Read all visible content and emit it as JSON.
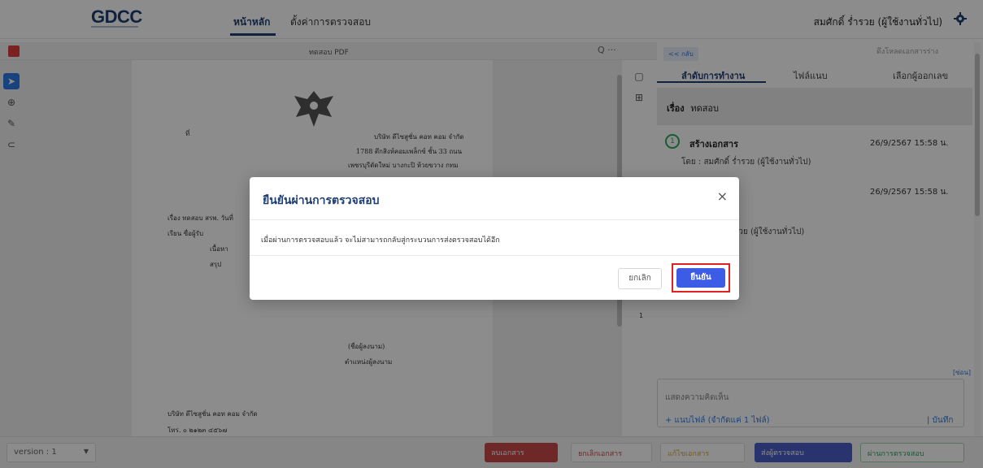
{
  "header": {
    "logo": "GDCC",
    "tabs": [
      {
        "label": "หน้าหลัก"
      },
      {
        "label": "ตั้งค่าการตรวจสอบ"
      }
    ],
    "user": "สมศักดิ์ ร่ำรวย (ผู้ใช้งานทั่วไป)",
    "gear_icon": "gear-icon"
  },
  "viewer": {
    "title": "ทดสอบ PDF",
    "tools_text": "Q ···",
    "page_number": "1"
  },
  "document": {
    "addr_label": "ที่",
    "company": "บริษัท ดีไซสูชั่น คอท คอม จำกัด",
    "address1": "1788 ตึกสิงห์คอมเพล็กซ์ ชั้น 33 ถนน",
    "address2": "เพชรบุรีตัดใหม่ บางกะปิ ห้วยขวาง กทม",
    "subject_line": "เรื่อง   ทดสอบ สรพ. วันที่",
    "to_line": "เรียน   ซื่อผู้รับ",
    "content": "เนื้อหา",
    "summary": "สรุป",
    "signer": "(ชื่อผู้ลงนาม)",
    "position": "ตำแหน่งผู้ลงนาม",
    "footer_company": "บริษัท ดีไซสูชั่น คอท คอม จำกัด",
    "footer_tel": "โทร. ๐ ๒๑๒๓ ๔๕๖๗"
  },
  "right_panel": {
    "back": "<< กลับ",
    "download": "ดึงโหลดเอกสารร่าง",
    "tabs": [
      "ลำดับการทำงาน",
      "ไฟล์แนบ",
      "เลือกผู้ออกเลข"
    ],
    "subject_label": "เรื่อง",
    "subject_value": "ทดสอบ",
    "step1": {
      "num": "1",
      "title": "สร้างเอกสาร",
      "date": "26/9/2567 15:58 น.",
      "by": "โดย : สมศักดิ์ ร่ำรวย (ผู้ใช้งานทั่วไป)"
    },
    "step2": {
      "date": "26/9/2567 15:58 น.",
      "by": "ร่ำรวย (ผู้ใช้งานทั่วไป)"
    },
    "hide": "[ซ่อน]",
    "comment_placeholder": "แสดงความคิดเห็น",
    "attach": "+  แนบไฟล์ (จำกัดแค่ 1 ไฟล์)",
    "save": "|  บันทึก"
  },
  "bottom": {
    "version": "version : 1",
    "delete": "ลบเอกสาร",
    "cancel_doc": "ยกเลิกเอกสาร",
    "edit": "แก้ไขเอกสาร",
    "send": "ส่งผู้ตรวจสอบ",
    "pass": "ผ่านการตรวจสอบ"
  },
  "modal": {
    "title": "ยืนยันผ่านการตรวจสอบ",
    "message": "เมื่อผ่านการตรวจสอบแล้ว จะไม่สามารถกลับสู่กระบวนการส่งตรวจสอบได้อีก",
    "cancel": "ยกเลิก",
    "confirm": "ยืนยัน",
    "close": "×"
  }
}
